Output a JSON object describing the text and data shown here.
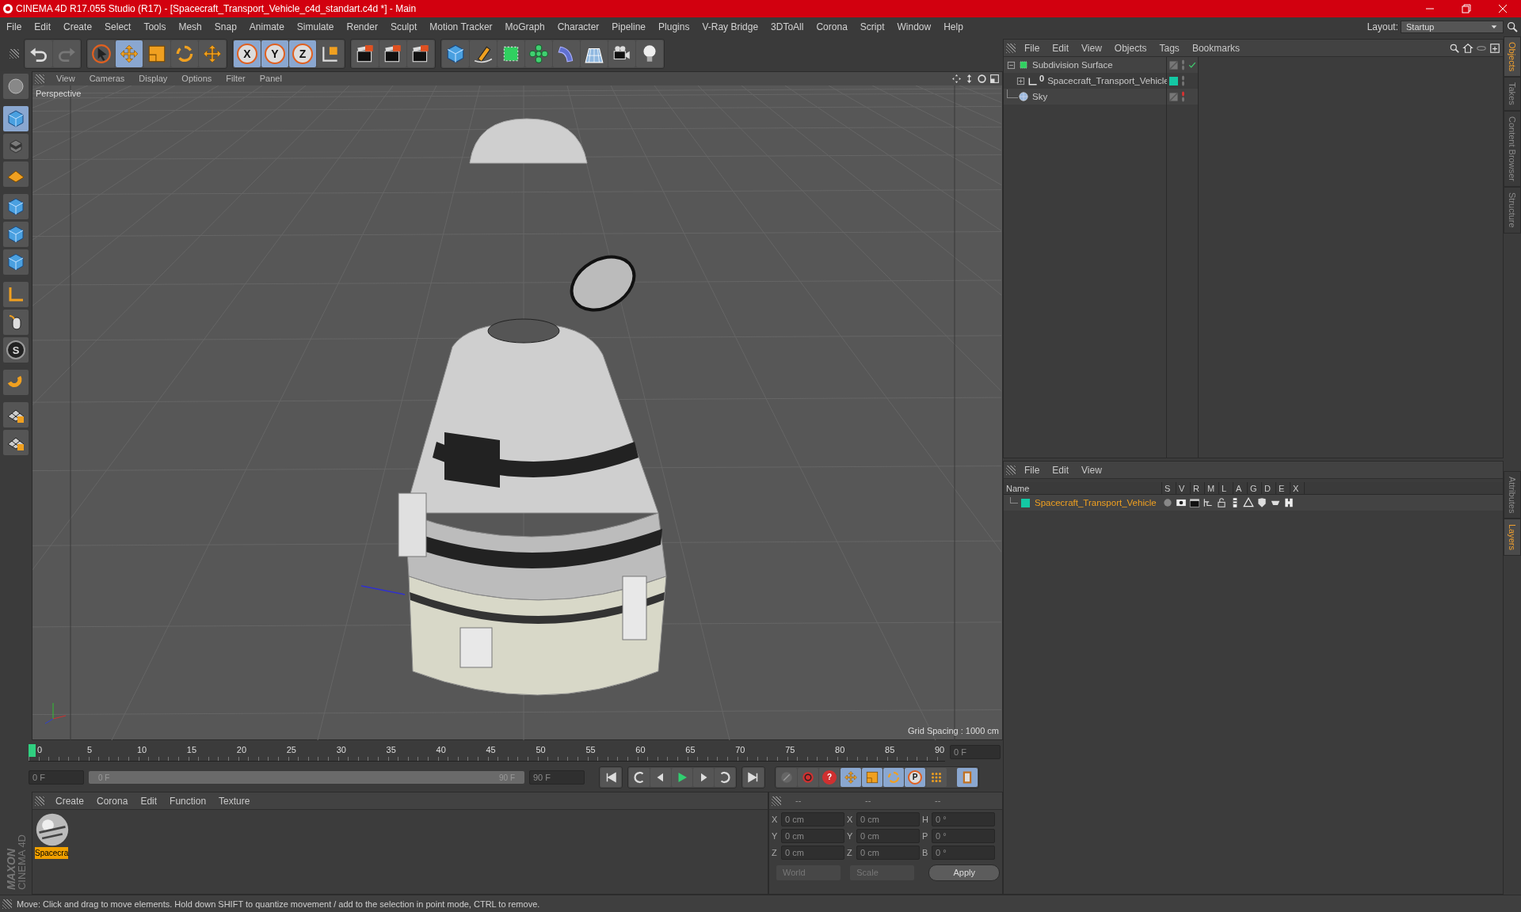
{
  "window": {
    "title": "CINEMA 4D R17.055 Studio (R17) - [Spacecraft_Transport_Vehicle_c4d_standart.c4d *] - Main"
  },
  "menu": [
    "File",
    "Edit",
    "Create",
    "Select",
    "Tools",
    "Mesh",
    "Snap",
    "Animate",
    "Simulate",
    "Render",
    "Sculpt",
    "Motion Tracker",
    "MoGraph",
    "Character",
    "Pipeline",
    "Plugins",
    "V-Ray Bridge",
    "3DToAll",
    "Corona",
    "Script",
    "Window",
    "Help"
  ],
  "layout": {
    "label": "Layout:",
    "value": "Startup"
  },
  "toolbar_groups": [
    [
      {
        "kind": "undo",
        "selected": false
      },
      {
        "kind": "redo",
        "selected": false
      }
    ],
    [
      {
        "kind": "select",
        "selected": false
      },
      {
        "kind": "move",
        "selected": true
      },
      {
        "kind": "scale",
        "selected": false
      },
      {
        "kind": "rotate",
        "selected": false
      },
      {
        "kind": "move",
        "selected": false
      }
    ],
    [
      {
        "kind": "x",
        "glyph": "X",
        "selected": true
      },
      {
        "kind": "y",
        "glyph": "Y",
        "selected": true
      },
      {
        "kind": "z",
        "glyph": "Z",
        "selected": true
      },
      {
        "kind": "coords",
        "selected": false
      }
    ],
    [
      {
        "kind": "render",
        "selected": false
      },
      {
        "kind": "render",
        "selected": false
      },
      {
        "kind": "render",
        "selected": false
      }
    ],
    [
      {
        "kind": "cube",
        "selected": false
      },
      {
        "kind": "pen",
        "selected": false
      },
      {
        "kind": "subdiv",
        "selected": false
      },
      {
        "kind": "cloner",
        "selected": false
      },
      {
        "kind": "deformer",
        "selected": false
      },
      {
        "kind": "floor",
        "selected": false
      },
      {
        "kind": "camera",
        "selected": false
      },
      {
        "kind": "light",
        "selected": false
      }
    ]
  ],
  "left_tools": [
    {
      "kind": "sphere",
      "selected": false
    },
    {
      "kind": "cube",
      "selected": true
    },
    {
      "kind": "checker",
      "selected": false
    },
    {
      "kind": "plane",
      "selected": false
    },
    {
      "kind": "cube",
      "selected": false
    },
    {
      "kind": "cube",
      "selected": false
    },
    {
      "kind": "cube",
      "selected": false
    },
    {
      "kind": "axis",
      "selected": false
    },
    {
      "kind": "mouse",
      "selected": false
    },
    {
      "kind": "snap",
      "glyph": "S",
      "selected": false
    },
    {
      "kind": "magnet",
      "selected": false
    },
    {
      "kind": "grid",
      "selected": false
    },
    {
      "kind": "grid",
      "selected": false
    }
  ],
  "viewport": {
    "menu": [
      "View",
      "Cameras",
      "Display",
      "Options",
      "Filter",
      "Panel"
    ],
    "camera": "Perspective",
    "grid_spacing": "Grid Spacing : 1000 cm"
  },
  "timeline": {
    "ticks": [
      "0",
      "5",
      "10",
      "15",
      "20",
      "25",
      "30",
      "35",
      "40",
      "45",
      "50",
      "55",
      "60",
      "65",
      "70",
      "75",
      "80",
      "85",
      "90"
    ],
    "playhead": {
      "level": 0
    },
    "current": "0 F",
    "start": "0 F",
    "range_start": "0 F",
    "range_end": "90 F",
    "end": "90 F",
    "transport": [
      {
        "kind": "first"
      },
      {
        "kind": "prev-key"
      },
      {
        "kind": "prev"
      },
      {
        "kind": "play"
      },
      {
        "kind": "next"
      },
      {
        "kind": "next-key"
      },
      {
        "kind": "last"
      }
    ],
    "keys": [
      {
        "kind": "record",
        "selected": false
      },
      {
        "kind": "autokey",
        "selected": false
      },
      {
        "kind": "keyinfo",
        "glyph": "?",
        "selected": false
      },
      {
        "kind": "move",
        "selected": true
      },
      {
        "kind": "scale",
        "selected": true
      },
      {
        "kind": "rotate",
        "selected": true
      },
      {
        "kind": "param",
        "glyph": "P",
        "selected": true
      },
      {
        "kind": "points",
        "selected": false
      },
      {
        "kind": "film",
        "selected": true
      }
    ]
  },
  "materials": {
    "menu": [
      "Create",
      "Corona",
      "Edit",
      "Function",
      "Texture"
    ],
    "items": [
      {
        "name": "Spacecra",
        "selected": true
      }
    ]
  },
  "coordinates": {
    "headers": [
      "--",
      "--",
      "--"
    ],
    "rows": [
      [
        {
          "label": "X",
          "value": "0 cm"
        },
        {
          "label": "X",
          "value": "0 cm"
        },
        {
          "label": "H",
          "value": "0 °"
        }
      ],
      [
        {
          "label": "Y",
          "value": "0 cm"
        },
        {
          "label": "Y",
          "value": "0 cm"
        },
        {
          "label": "P",
          "value": "0 °"
        }
      ],
      [
        {
          "label": "Z",
          "value": "0 cm"
        },
        {
          "label": "Z",
          "value": "0 cm"
        },
        {
          "label": "B",
          "value": "0 °"
        }
      ]
    ],
    "dropdowns": [
      "World",
      "Scale"
    ],
    "apply": "Apply"
  },
  "logo": {
    "brand": "MAXON",
    "product": "CINEMA 4D"
  },
  "status_bar": "Move: Click and drag to move elements. Hold down SHIFT to quantize movement / add to the selection in point mode, CTRL to remove.",
  "objects": {
    "menu": [
      "File",
      "Edit",
      "View",
      "Objects",
      "Tags",
      "Bookmarks"
    ],
    "tree": [
      {
        "name": "Subdivision Surface",
        "kind": "subdivision",
        "expanded": true,
        "checked": true,
        "render_off": false,
        "children": [
          {
            "name": "Spacecraft_Transport_Vehicle",
            "kind": "null",
            "glyph": "0",
            "expanded": false,
            "checked": false,
            "render_off": false,
            "color": "#14c8a4"
          }
        ]
      },
      {
        "name": "Sky",
        "kind": "sky",
        "checked": false,
        "render_off": true
      }
    ]
  },
  "layers": {
    "menu": [
      "File",
      "Edit",
      "View"
    ],
    "columns": [
      "Name",
      "S",
      "V",
      "R",
      "M",
      "L",
      "A",
      "G",
      "D",
      "E",
      "X"
    ],
    "rows": [
      {
        "name": "Spacecraft_Transport_Vehicle",
        "color": "#14c8a4"
      }
    ]
  },
  "side_tabs_top": [
    {
      "label": "Objects",
      "selected": true
    },
    {
      "label": "Takes",
      "selected": false
    },
    {
      "label": "Content Browser",
      "selected": false
    },
    {
      "label": "Structure",
      "selected": false
    }
  ],
  "side_tabs_bottom": [
    {
      "label": "Attributes",
      "selected": false
    },
    {
      "label": "Layers",
      "selected": true
    }
  ]
}
